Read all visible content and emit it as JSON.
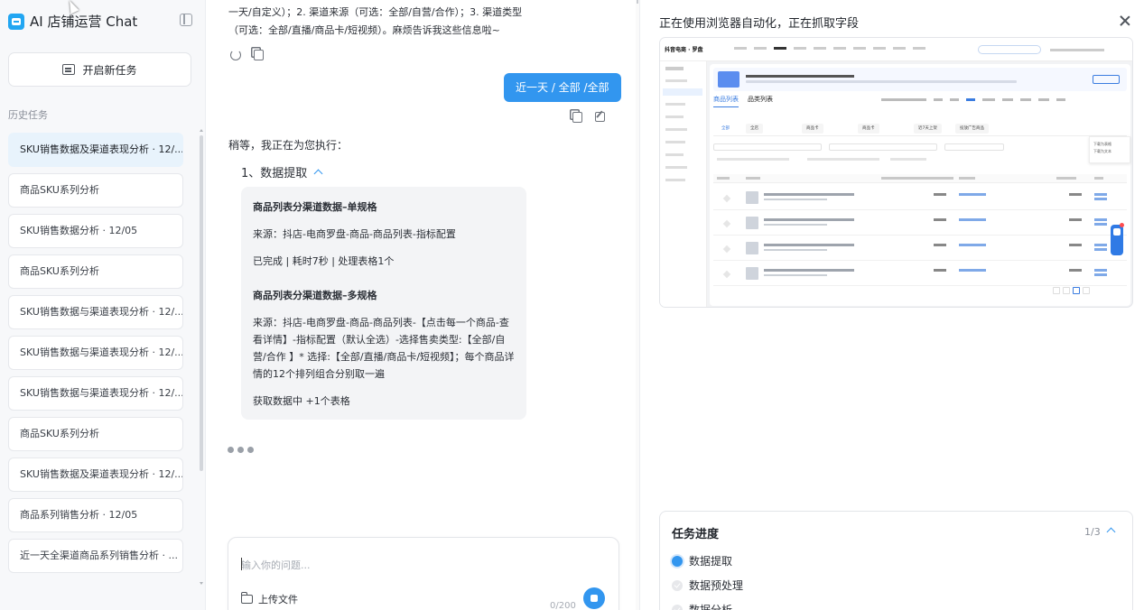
{
  "sidebar": {
    "brand_title": "AI 店铺运营 Chat",
    "new_task_label": "开启新任务",
    "history_label": "历史任务",
    "history": [
      "SKU销售数据及渠道表现分析 · 12/...",
      "商品SKU系列分析",
      "SKU销售数据分析 · 12/05",
      "商品SKU系列分析",
      "SKU销售数据与渠道表现分析 · 12/...",
      "SKU销售数据与渠道表现分析 · 12/...",
      "SKU销售数据与渠道表现分析 · 12/...",
      "商品SKU系列分析",
      "SKU销售数据及渠道表现分析 · 12/...",
      "商品系列销售分析 · 12/05",
      "近一天全渠道商品系列销售分析 · ..."
    ]
  },
  "chat": {
    "prev_message": "一天/自定义）；2. 渠道来源（可选：全部/自营/合作）；3. 渠道类型（可选：全部/直播/商品卡/短视频）。麻烦告诉我这些信息啦~",
    "user_message": "近一天 / 全部 /全部",
    "assistant_intro": "稍等，我正在为您执行：",
    "step_title": "1、数据提取",
    "card": {
      "h1": "商品列表分渠道数据–单规格",
      "l1": "来源：抖店-电商罗盘-商品-商品列表-指标配置",
      "l2": "已完成 | 耗时7秒 | 处理表格1个",
      "h2": "商品列表分渠道数据–多规格",
      "l3": "来源：抖店-电商罗盘-商品-商品列表-【点击每一个商品-查看详情】-指标配置（默认全选）-选择售卖类型:【全部/自营/合作 】* 选择:【全部/直播/商品卡/短视频】；每个商品详情的12个排列组合分别取一遍",
      "l4": "获取数据中 +1个表格"
    },
    "input_placeholder": "输入你的问题...",
    "upload_label": "上传文件",
    "char_counter": "0/200"
  },
  "panel": {
    "title": "正在使用浏览器自动化，正在抓取字段",
    "browser": {
      "brand": "抖音电商 · 罗盘",
      "tab_active": "商品列表",
      "tab_other": "品类列表",
      "chip_labels": [
        "全部",
        "全店",
        "商品卡",
        "商品卡",
        "近7天上架",
        "投放广告商品"
      ],
      "dropdown_items": [
        "下载为表格",
        "下载为文本"
      ]
    },
    "progress": {
      "title": "任务进度",
      "count": "1/3",
      "steps": [
        "数据提取",
        "数据预处理",
        "数据分析"
      ]
    }
  },
  "colors": {
    "accent": "#3296ef",
    "active_history": "#e8f3fc"
  }
}
